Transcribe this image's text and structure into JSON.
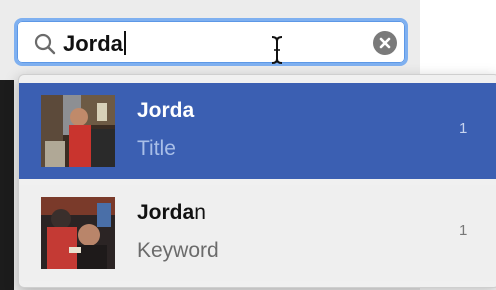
{
  "search": {
    "query": "Jorda",
    "placeholder": ""
  },
  "suggestions": [
    {
      "match": "Jorda",
      "rest": "",
      "type": "Title",
      "count": "1",
      "selected": true,
      "thumbnail": "photo-thumbnail"
    },
    {
      "match": "Jorda",
      "rest": "n",
      "type": "Keyword",
      "count": "1",
      "selected": false,
      "thumbnail": "photo-thumbnail"
    }
  ],
  "icons": {
    "search": "magnifier-icon",
    "clear": "clear-circle-icon",
    "cursor": "ibeam-cursor"
  },
  "colors": {
    "selection": "#3b5fb2",
    "focus_ring": "#7fb0f0"
  }
}
